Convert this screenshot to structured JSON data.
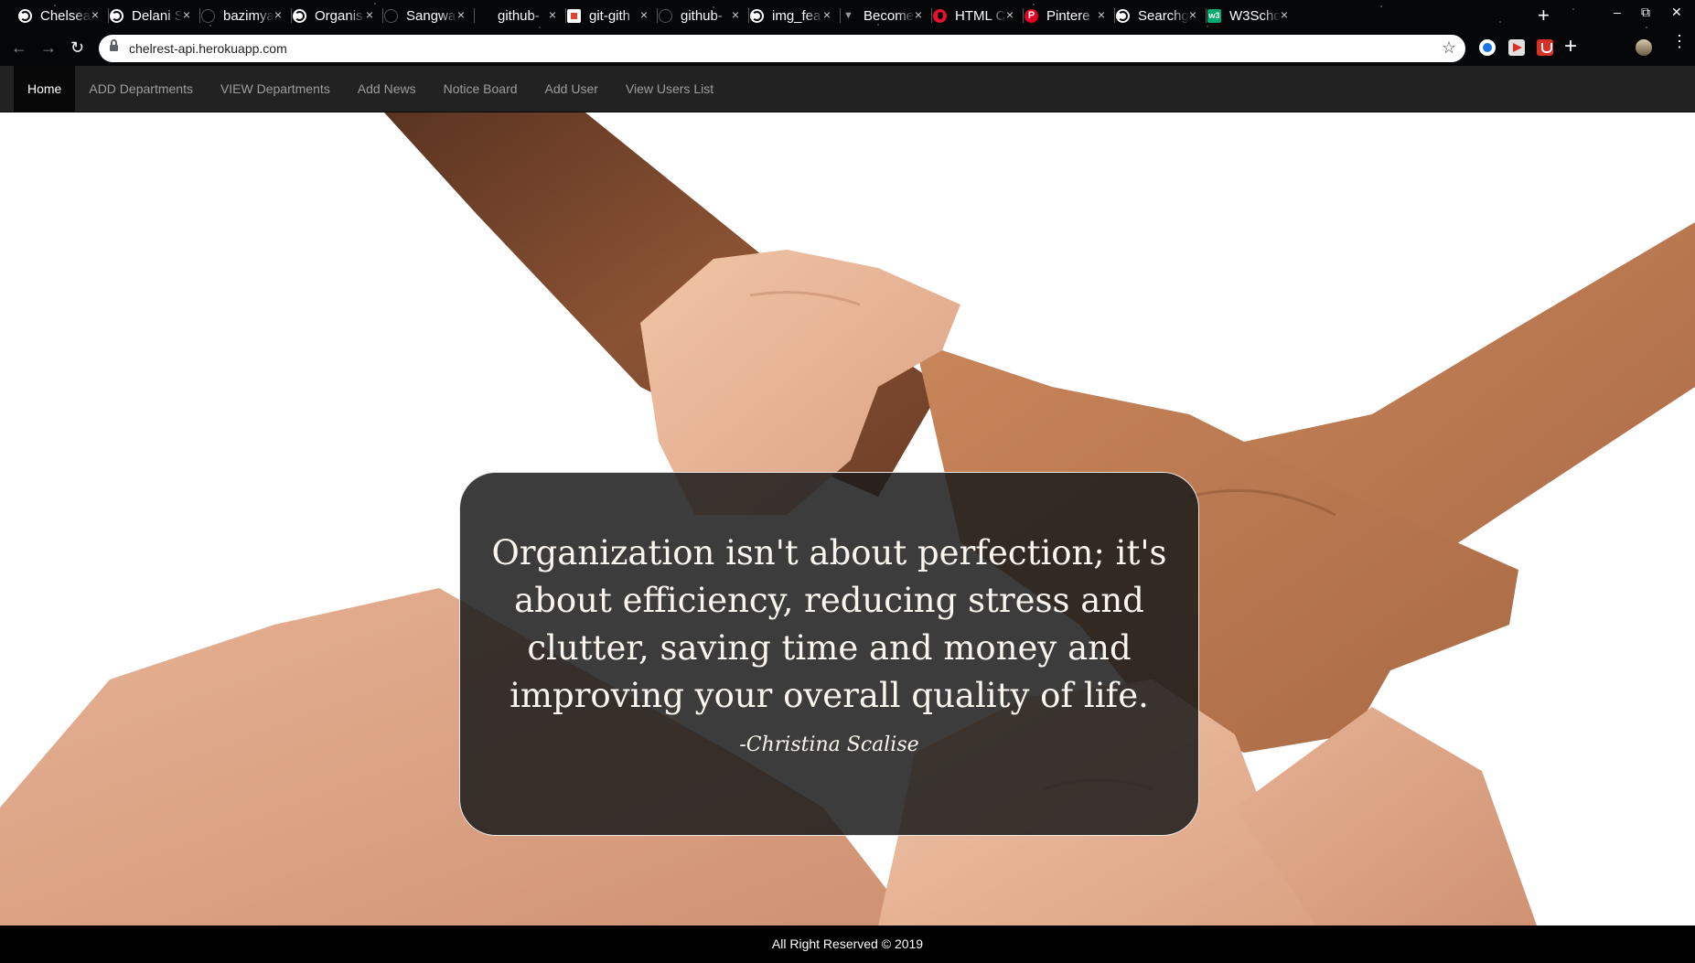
{
  "browser": {
    "tabs": [
      {
        "label": "Chelsea",
        "icon": "globe"
      },
      {
        "label": "Delani S",
        "icon": "globe"
      },
      {
        "label": "bazimya",
        "icon": "github"
      },
      {
        "label": "Organis",
        "icon": "globe"
      },
      {
        "label": "Sangwa",
        "icon": "github"
      },
      {
        "label": "github-",
        "icon": "none"
      },
      {
        "label": "git-gith",
        "icon": "gitlab"
      },
      {
        "label": "github-",
        "icon": "github"
      },
      {
        "label": "img_fea",
        "icon": "globe"
      },
      {
        "label": "Become",
        "icon": "medium"
      },
      {
        "label": "HTML C",
        "icon": "opera"
      },
      {
        "label": "Pintere",
        "icon": "pinterest"
      },
      {
        "label": "Searchg",
        "icon": "globe"
      },
      {
        "label": "W3Scho",
        "icon": "w3"
      }
    ],
    "tab_close_glyph": "×",
    "new_tab_glyph": "+",
    "url": "chelrest-api.herokuapp.com"
  },
  "navbar": {
    "items": [
      {
        "label": "Home",
        "active": true
      },
      {
        "label": "ADD Departments",
        "active": false
      },
      {
        "label": "VIEW Departments",
        "active": false
      },
      {
        "label": "Add News",
        "active": false
      },
      {
        "label": "Notice Board",
        "active": false
      },
      {
        "label": "Add User",
        "active": false
      },
      {
        "label": "View Users List",
        "active": false
      }
    ]
  },
  "quote": {
    "text": "Organization isn't about perfection; it's about efficiency, reducing stress and clutter, saving time and money and improving your overall quality of life.",
    "author": "-Christina Scalise"
  },
  "footer": {
    "text": "All Right Reserved © 2019"
  },
  "colors": {
    "navbar_bg": "#222222",
    "navbar_active_bg": "#080808",
    "nav_link": "#9d9d9d",
    "card_bg": "#1c1c1c",
    "footer_bg": "#000000"
  }
}
